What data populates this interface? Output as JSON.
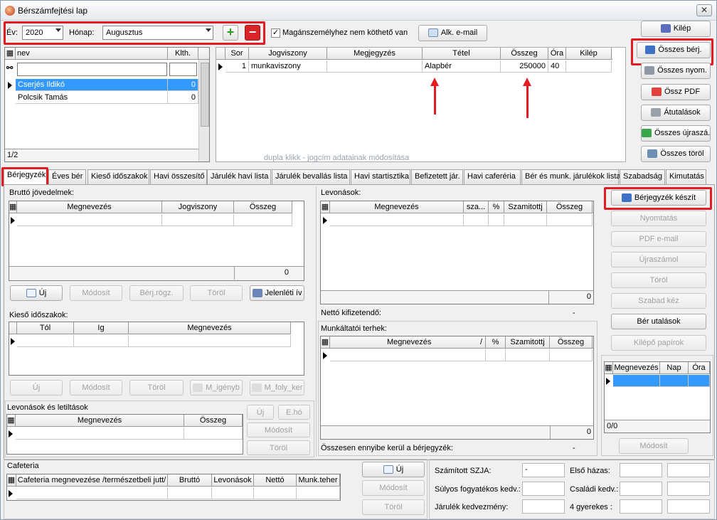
{
  "window": {
    "title": "Bérszámfejtési lap",
    "close": "✕"
  },
  "toolbar": {
    "year_label": "Év:",
    "year_value": "2020",
    "month_label": "Hónap:",
    "month_value": "Augusztus",
    "add": "+",
    "remove": "−",
    "checkbox_label": "Magánszemélyhez nem köthető van",
    "checkbox_mark": "✓",
    "email_button": "Alk. e-mail"
  },
  "employees": {
    "col_name": "nev",
    "col_klth": "Klth.",
    "rows": [
      {
        "name": "Cserjés Ildikó",
        "klth": "0"
      },
      {
        "name": "Polcsik Tamás",
        "klth": "0"
      }
    ],
    "footer": "1/2"
  },
  "items": {
    "columns": [
      "Sor",
      "Jogviszony",
      "Megjegyzés",
      "Tétel",
      "Összeg",
      "Óra",
      "Kilép"
    ],
    "rows": [
      {
        "sor": "1",
        "jogviszony": "munkaviszony",
        "megjegyzes": "",
        "tetel": "Alapbér",
        "osszeg": "250000",
        "ora": "40",
        "kilep": ""
      }
    ],
    "hint": "dupla klikk - jogcím adatainak módosítása"
  },
  "right_buttons": [
    "Kilép",
    "Összes bérj.",
    "Összes nyom.",
    "Össz PDF",
    "Átutalások",
    "Összes újraszá.",
    "Összes töröl"
  ],
  "tabs": [
    "Bérjegyzék",
    "Éves bér",
    "Kieső időszakok",
    "Havi összesítő",
    "Járulék havi lista",
    "Járulék bevallás lista",
    "Havi startisztika",
    "Befizetett jár.",
    "Havi caferéria",
    "Bér és munk. járulékok lista",
    "Szabadság",
    "Kimutatás"
  ],
  "brutto": {
    "title": "Bruttó jövedelmek:",
    "columns": [
      "Megnevezés",
      "Jogviszony",
      "Összeg"
    ],
    "total": "0",
    "buttons": [
      "Új",
      "Módosít",
      "Bérj.rögz.",
      "Töröl",
      "Jelenléti ív"
    ]
  },
  "kieso": {
    "title": "Kieső időszakok:",
    "columns": [
      "Tól",
      "Ig",
      "Megnevezés"
    ],
    "buttons": [
      "Új",
      "Módosít",
      "Töröl",
      "M_igényb",
      "M_foly_ker"
    ]
  },
  "levonasok_letiltasok": {
    "title": "Levonások és letiltások",
    "columns": [
      "Megnevezés",
      "Összeg"
    ],
    "buttons": [
      "Új",
      "E.hó",
      "Módosít",
      "Töröl"
    ]
  },
  "levonasok": {
    "title": "Levonások:",
    "columns": [
      "Megnevezés",
      "sza...",
      "%",
      "Szamitottj",
      "Összeg"
    ],
    "total": "0",
    "netto_label": "Nettó kifizetendő:",
    "netto_value": "-"
  },
  "munkaltatoi": {
    "title": "Munkáltatói terhek:",
    "columns": [
      "Megnevezés",
      "/",
      "%",
      "Szamitottj",
      "Összeg"
    ],
    "total": "0",
    "sum_label": "Összesen ennyibe kerül a bérjegyzék:",
    "sum_value": "-"
  },
  "berjegyzek_buttons": [
    "Bérjegyzék készít",
    "Nyomtatás",
    "PDF e-mail",
    "Újraszámol",
    "Töröl",
    "Szabad kéz",
    "Bér utalások",
    "Kilépő papírok"
  ],
  "small_grid": {
    "columns": [
      "Megnevezés",
      "Nap",
      "Óra"
    ],
    "footer": "0/0",
    "button": "Módosít"
  },
  "cafeteria": {
    "title": "Cafeteria",
    "columns": [
      "Cafeteria megnevezése /természetbeli jutt/",
      "Bruttó",
      "Levonások",
      "Nettó",
      "Munk.teher"
    ],
    "buttons": [
      "Új",
      "Módosít",
      "Töröl"
    ]
  },
  "tax": {
    "szja_label": "Számított SZJA:",
    "szja_value": "-",
    "elso_hazas": "Első házas:",
    "sulyos": "Súlyos fogyatékos kedv.:",
    "csaladi": "Családi kedv.:",
    "jarulek": "Járulék kedvezmény:",
    "gyerekes": "4 gyerekes :"
  }
}
